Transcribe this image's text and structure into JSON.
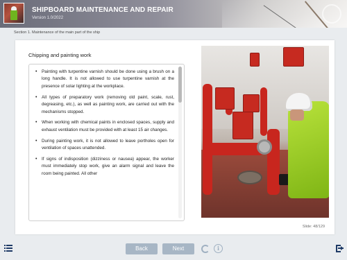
{
  "header": {
    "title": "SHIPBOARD MAINTENANCE AND REPAIR",
    "version": "Version 1.0/2022"
  },
  "section": "Section 1. Maintenance of the main part of the ship",
  "content": {
    "heading": "Chipping and painting work",
    "bullets": [
      "Painting with turpentine varnish should be done using a brush on a long handle. It is not allowed to use turpentine varnish at the presence of solar lighting at the workplace.",
      "All types of preparatory work (removing old paint, scale, rust, degreasing, etc.), as well as painting work, are carried out with the mechanisms stopped.",
      "When working with chemical paints in enclosed spaces, supply and exhaust ventilation must be provided with at least 15 air changes.",
      "During painting work, it is not allowed to leave portholes open for ventilation of spaces unattended.",
      "If signs of indisposition (dizziness or nausea) appear, the worker must immediately stop work, give an alarm signal and leave the room being painted. All other"
    ],
    "scroll_position": 0.0
  },
  "slide_counter": "Slide: 48/129",
  "footer": {
    "back_label": "Back",
    "next_label": "Next",
    "info_glyph": "i"
  },
  "icons": {
    "menu": "menu-list-icon",
    "reload": "reload-icon",
    "info": "info-icon",
    "exit": "exit-icon"
  },
  "colors": {
    "accent": "#1e3a66",
    "button": "#a7b6c5"
  }
}
